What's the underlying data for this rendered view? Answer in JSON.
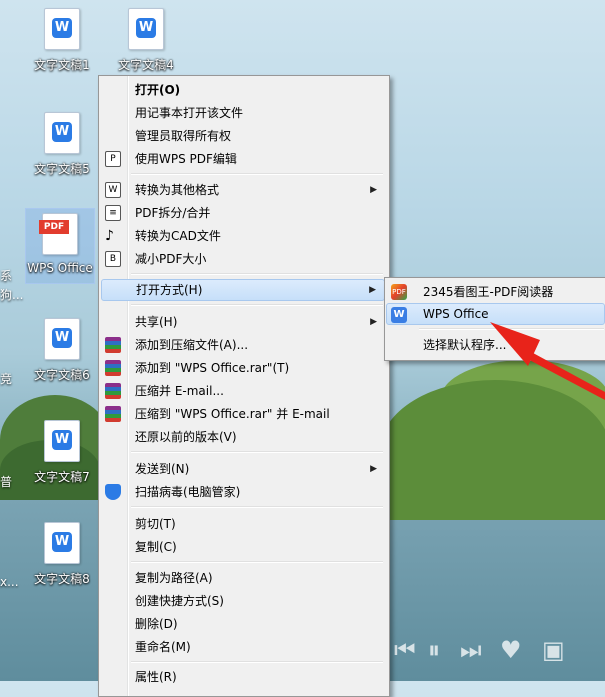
{
  "desktop": {
    "icons": [
      {
        "label": "文字文稿1"
      },
      {
        "label": "文字文稿4"
      },
      {
        "label": "文字文稿5"
      },
      {
        "label": "WPS Office"
      },
      {
        "label": "文字文稿6"
      },
      {
        "label": "文字文稿7"
      },
      {
        "label": "文字文稿8"
      }
    ],
    "edge_labels": [
      "系",
      "狗...",
      "竞",
      "普",
      "x..."
    ]
  },
  "context_menu": {
    "items": [
      {
        "label": "打开(O)"
      },
      {
        "label": "用记事本打开该文件"
      },
      {
        "label": "管理员取得所有权"
      },
      {
        "label": "使用WPS PDF编辑"
      },
      {
        "label": "转换为其他格式"
      },
      {
        "label": "PDF拆分/合并"
      },
      {
        "label": "转换为CAD文件"
      },
      {
        "label": "减小PDF大小"
      },
      {
        "label": "打开方式(H)"
      },
      {
        "label": "共享(H)"
      },
      {
        "label": "添加到压缩文件(A)..."
      },
      {
        "label": "添加到 \"WPS Office.rar\"(T)"
      },
      {
        "label": "压缩并 E-mail..."
      },
      {
        "label": "压缩到 \"WPS Office.rar\" 并 E-mail"
      },
      {
        "label": "还原以前的版本(V)"
      },
      {
        "label": "发送到(N)"
      },
      {
        "label": "扫描病毒(电脑管家)"
      },
      {
        "label": "剪切(T)"
      },
      {
        "label": "复制(C)"
      },
      {
        "label": "复制为路径(A)"
      },
      {
        "label": "创建快捷方式(S)"
      },
      {
        "label": "删除(D)"
      },
      {
        "label": "重命名(M)"
      },
      {
        "label": "属性(R)"
      }
    ]
  },
  "open_with_submenu": {
    "items": [
      {
        "label": "2345看图王-PDF阅读器"
      },
      {
        "label": "WPS Office"
      },
      {
        "label": "选择默认程序..."
      }
    ]
  },
  "icon_glyphs": {
    "doc_letter": "W",
    "pdf_badge": "PDF",
    "submenu_arrow": "▶",
    "k2345_badge": "PDF",
    "wps_badge": "W"
  },
  "media_controls": [
    "⏮",
    "⏸",
    "⏭",
    "♥",
    "▣"
  ],
  "colors": {
    "accent_blue": "#2b7be5",
    "pdf_red": "#e23c2e",
    "annotation_arrow": "#e8231a"
  }
}
